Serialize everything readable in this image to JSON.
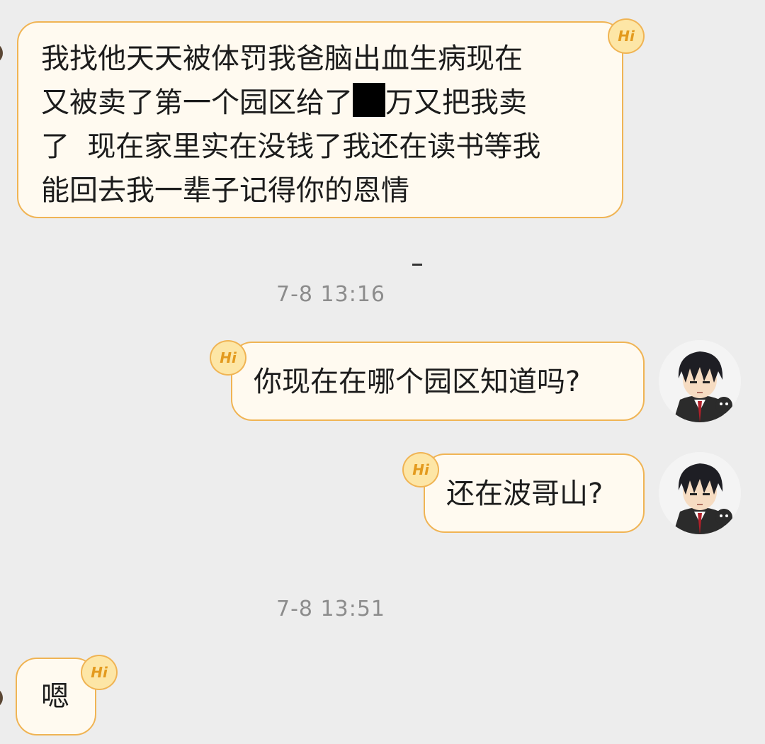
{
  "messages": [
    {
      "side": "received",
      "badge": "Hi",
      "line1": "我找他天天被体罚我爸脑出血生病现在",
      "line2_before": "又被卖了第一个园区给了",
      "line2_after": "万又把我卖",
      "line3": "了  现在家里实在没钱了我还在读书等我",
      "line4": "能回去我一辈子记得你的恩情"
    },
    {
      "side": "sent",
      "badge": "Hi",
      "text": "你现在在哪个园区知道吗?"
    },
    {
      "side": "sent",
      "badge": "Hi",
      "text": "还在波哥山?"
    },
    {
      "side": "received",
      "badge": "Hi",
      "text": "嗯"
    }
  ],
  "timestamps": [
    "7-8 13:16",
    "7-8 13:51"
  ],
  "colors": {
    "background": "#ededed",
    "bubble_fill": "#fffaf0",
    "bubble_border": "#f0b454",
    "badge_fill": "#fde6a6",
    "badge_text": "#e39a1e",
    "timestamp": "#8c8c8c"
  },
  "icons": {
    "badge": "hi-badge-icon",
    "avatar": "anime-boy-avatar"
  }
}
